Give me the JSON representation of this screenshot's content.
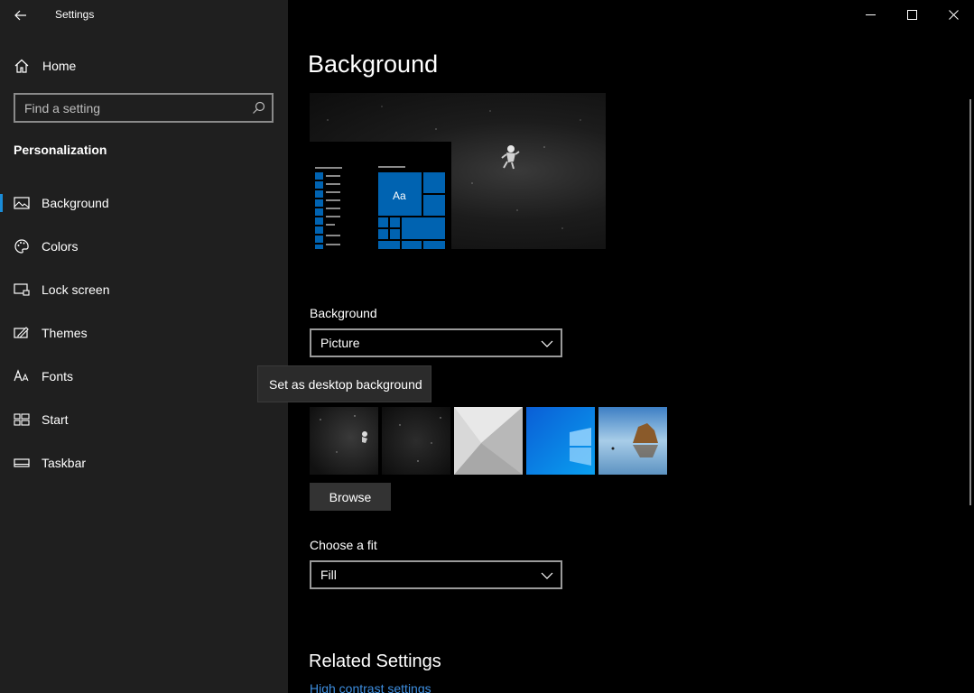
{
  "window": {
    "title": "Settings",
    "controls": {
      "minimize": "minimize-icon",
      "maximize": "maximize-icon",
      "close": "close-icon"
    }
  },
  "sidebar": {
    "home_label": "Home",
    "search": {
      "placeholder": "Find a setting"
    },
    "section_title": "Personalization",
    "items": [
      {
        "label": "Background",
        "icon": "picture-icon",
        "active": true
      },
      {
        "label": "Colors",
        "icon": "palette-icon",
        "active": false
      },
      {
        "label": "Lock screen",
        "icon": "lock-screen-icon",
        "active": false
      },
      {
        "label": "Themes",
        "icon": "themes-icon",
        "active": false
      },
      {
        "label": "Fonts",
        "icon": "fonts-icon",
        "active": false
      },
      {
        "label": "Start",
        "icon": "start-icon",
        "active": false
      },
      {
        "label": "Taskbar",
        "icon": "taskbar-icon",
        "active": false
      }
    ]
  },
  "main": {
    "page_title": "Background",
    "preview": {
      "tile_label": "Aa"
    },
    "background_field": {
      "label": "Background",
      "value": "Picture"
    },
    "tooltip": "Set as desktop background",
    "browse_label": "Browse",
    "fit_field": {
      "label": "Choose a fit",
      "value": "Fill"
    },
    "related_title": "Related Settings",
    "related_links": [
      "High contrast settings"
    ]
  },
  "colors": {
    "accent": "#0063b1",
    "link": "#3d8ee0",
    "sidebar_bg": "#1f1f1f",
    "main_bg": "#000000"
  }
}
